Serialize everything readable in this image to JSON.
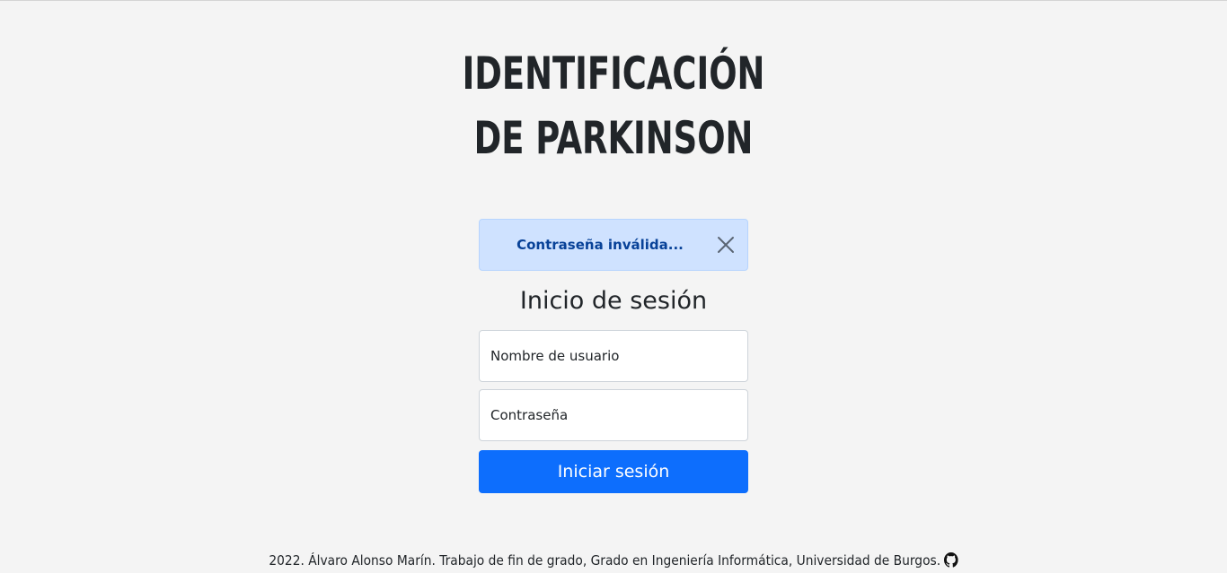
{
  "header": {
    "title_line1": "IDENTIFICACIÓN",
    "title_line2": "DE PARKINSON"
  },
  "alert": {
    "message": "Contraseña inválida...",
    "close_icon": "close-icon",
    "colors": {
      "background": "#cfe2ff",
      "border": "#b6d4fe",
      "text": "#084298"
    }
  },
  "login": {
    "heading": "Inicio de sesión",
    "username_placeholder": "Nombre de usuario",
    "password_placeholder": "Contraseña",
    "submit_label": "Iniciar sesión",
    "submit_color": "#0d6efd"
  },
  "footer": {
    "text": "2022. Álvaro Alonso Marín. Trabajo de fin de grado, Grado en Ingeniería Informática, Universidad de Burgos.",
    "link_icon": "github-icon"
  }
}
